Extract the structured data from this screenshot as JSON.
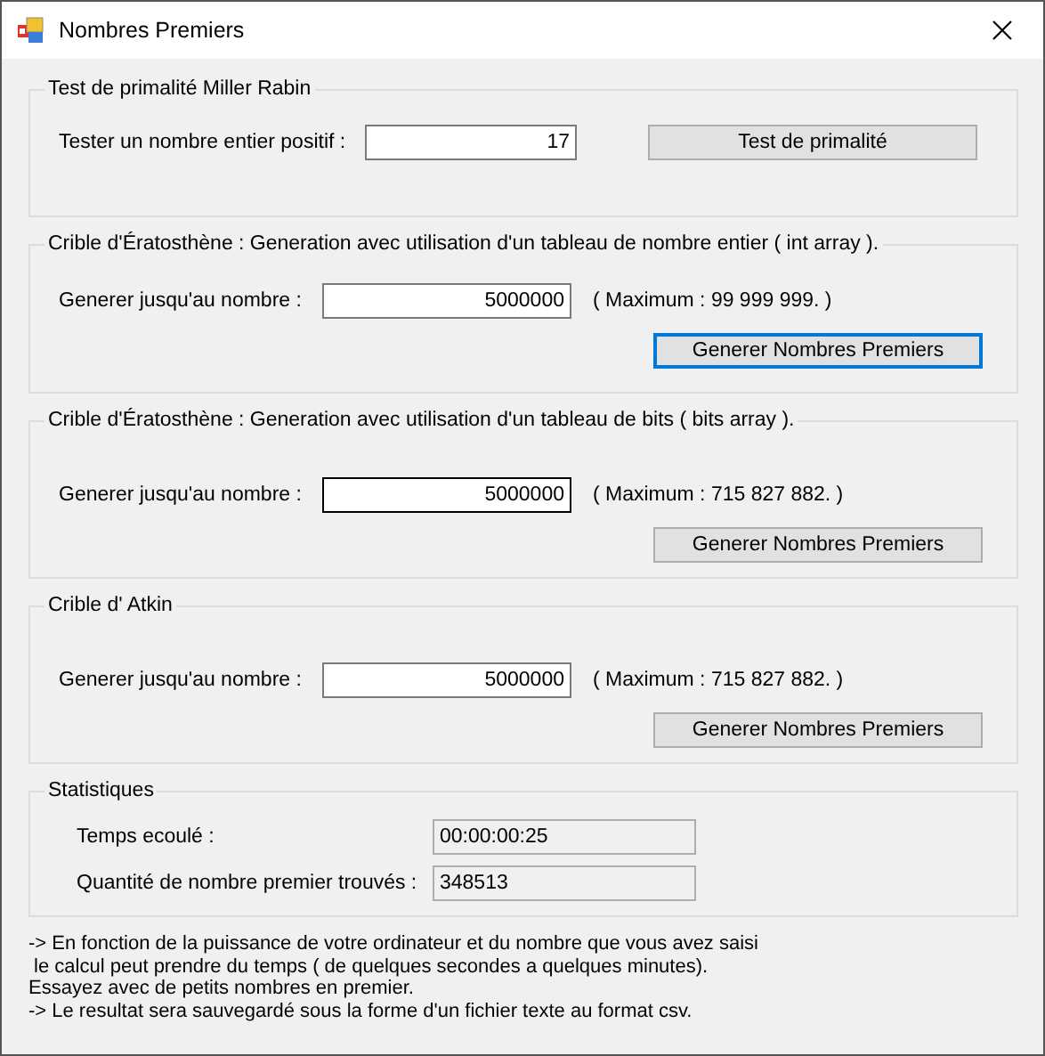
{
  "window": {
    "title": "Nombres Premiers"
  },
  "primality_test": {
    "title": "Test de primalité Miller Rabin",
    "label": "Tester un nombre entier positif :",
    "value": "17",
    "input_focused": false,
    "button": {
      "label": "Test de primalité",
      "focused": false
    }
  },
  "sieves": [
    {
      "title": "Crible d'Ératosthène : Generation avec utilisation d'un tableau de nombre entier ( int array ).",
      "label": "Generer jusqu'au nombre :",
      "value": "5000000",
      "input_focused": false,
      "maximum": "( Maximum :  99 999 999. )",
      "button": {
        "label": "Generer Nombres Premiers",
        "focused": true
      }
    },
    {
      "title": "Crible d'Ératosthène : Generation avec utilisation d'un tableau de bits ( bits array ).",
      "label": "Generer jusqu'au nombre :",
      "value": "5000000",
      "input_focused": true,
      "maximum": "( Maximum :  715 827 882. )",
      "button": {
        "label": "Generer Nombres Premiers",
        "focused": false
      }
    },
    {
      "title": "Crible d' Atkin",
      "label": "Generer jusqu'au nombre :",
      "value": "5000000",
      "input_focused": false,
      "maximum": "( Maximum :  715 827 882. )",
      "button": {
        "label": "Generer Nombres Premiers",
        "focused": false
      }
    }
  ],
  "statistics": {
    "title": "Statistiques",
    "rows": [
      {
        "label": "Temps ecoulé :",
        "value": "00:00:00:25"
      },
      {
        "label": "Quantité de nombre premier trouvés :",
        "value": "348513"
      }
    ]
  },
  "notes": [
    "-> En fonction de la puissance de votre ordinateur et du nombre que vous avez saisi",
    " le calcul peut prendre du temps ( de quelques secondes a quelques minutes).",
    "Essayez avec de petits nombres en premier.",
    "-> Le resultat sera sauvegardé sous la forme d'un fichier texte au format csv."
  ]
}
